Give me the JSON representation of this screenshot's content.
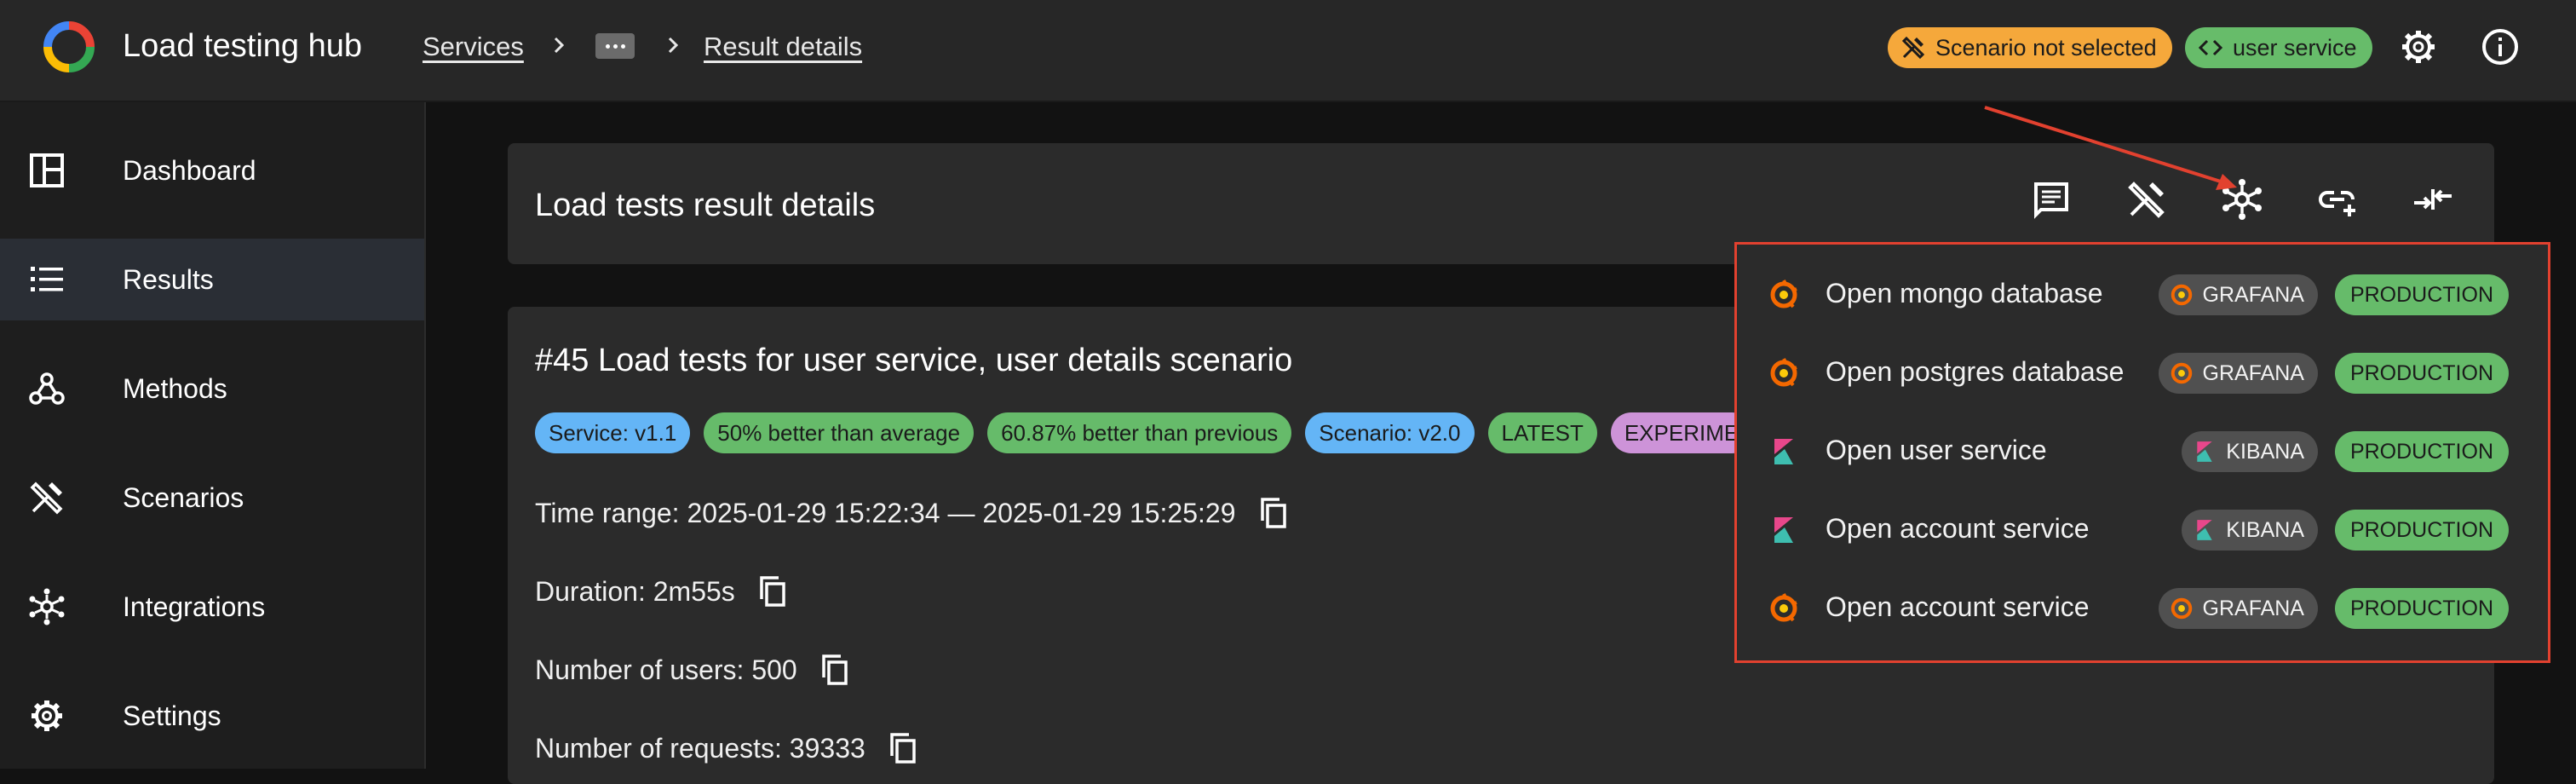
{
  "header": {
    "app_title": "Load testing hub",
    "breadcrumbs": [
      "Services",
      "Result details"
    ],
    "scenario_chip": "Scenario not selected",
    "service_chip": "user service"
  },
  "sidebar": {
    "items": [
      {
        "label": "Dashboard",
        "icon": "dashboard-icon"
      },
      {
        "label": "Results",
        "icon": "list-icon",
        "active": true
      },
      {
        "label": "Methods",
        "icon": "webhook-icon"
      },
      {
        "label": "Scenarios",
        "icon": "tools-icon"
      },
      {
        "label": "Integrations",
        "icon": "hub-icon"
      },
      {
        "label": "Settings",
        "icon": "gear-icon"
      }
    ]
  },
  "main": {
    "header_title": "Load tests result details",
    "result_title": "#45 Load tests for user service, user details scenario",
    "chips": [
      {
        "label": "Service: v1.1",
        "color": "#64b5f6"
      },
      {
        "label": "50% better than average",
        "color": "#66bb6a"
      },
      {
        "label": "60.87% better than previous",
        "color": "#66bb6a"
      },
      {
        "label": "Scenario: v2.0",
        "color": "#64b5f6"
      },
      {
        "label": "LATEST",
        "color": "#66bb6a"
      },
      {
        "label": "EXPERIME",
        "color": "#cd93d8"
      }
    ],
    "info": {
      "time_range": "Time range: 2025-01-29 15:22:34 — 2025-01-29 15:25:29",
      "duration": "Duration: 2m55s",
      "users": "Number of users: 500",
      "requests": "Number of requests: 39333"
    }
  },
  "integrations_menu": {
    "items": [
      {
        "label": "Open mongo database",
        "tool": "GRAFANA",
        "env": "PRODUCTION"
      },
      {
        "label": "Open postgres database",
        "tool": "GRAFANA",
        "env": "PRODUCTION"
      },
      {
        "label": "Open user service",
        "tool": "KIBANA",
        "env": "PRODUCTION"
      },
      {
        "label": "Open account service",
        "tool": "KIBANA",
        "env": "PRODUCTION"
      },
      {
        "label": "Open account service",
        "tool": "GRAFANA",
        "env": "PRODUCTION"
      }
    ]
  },
  "colors": {
    "accent_warning": "#f5a83b",
    "accent_success": "#66bb6a",
    "highlight_border": "#e2412f"
  }
}
